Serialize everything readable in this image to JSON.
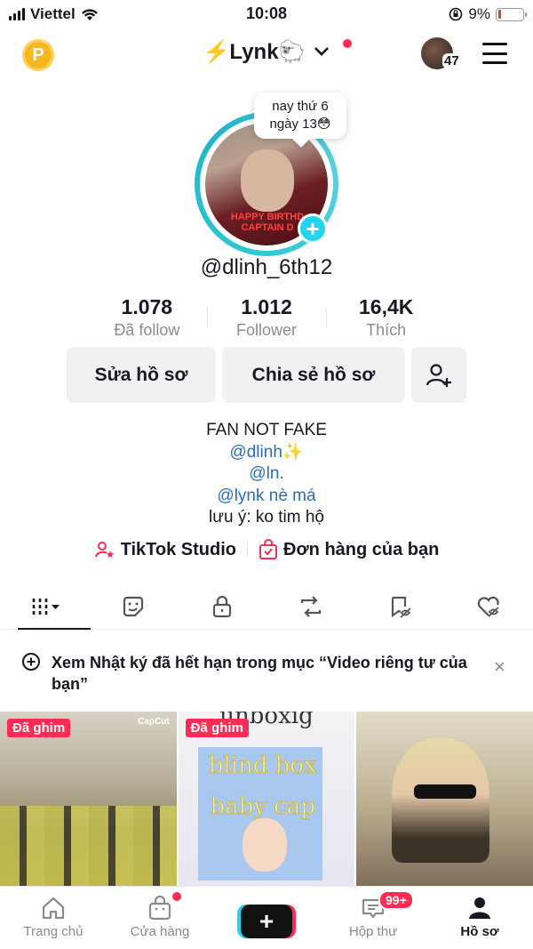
{
  "status_bar": {
    "carrier": "Viettel",
    "time": "10:08",
    "battery": "9%"
  },
  "top_nav": {
    "coin_label": "P",
    "account_name": "⚡️Lynk🐑",
    "friends_count": "47"
  },
  "profile": {
    "bubble_line1": "nay thứ 6",
    "bubble_line2": "ngày 13😳",
    "avatar_text_line1": "HAPPY BIRTHD",
    "avatar_text_line2": "CAPTAIN D",
    "username": "@dlinh_6th12",
    "stats": [
      {
        "value": "1.078",
        "label": "Đã follow"
      },
      {
        "value": "1.012",
        "label": "Follower"
      },
      {
        "value": "16,4K",
        "label": "Thích"
      }
    ],
    "edit_button": "Sửa hồ sơ",
    "share_button": "Chia sẻ hồ sơ",
    "bio": {
      "line1": "FAN NOT FAKE",
      "line2": "@dlinh✨",
      "line3": "@ln.",
      "line4": "@lynk nè má",
      "line5": "lưu ý: ko tim hộ"
    },
    "studio": "TikTok Studio",
    "orders": "Đơn hàng của bạn"
  },
  "notice": {
    "text": "Xem Nhật ký đã hết hạn trong mục “Video riêng tư của bạn”",
    "close": "×"
  },
  "videos": {
    "pinned_label": "Đã ghim",
    "capcut": "CapCut",
    "unbox_text": "unboxig",
    "blindbox_line1": "blind box",
    "blindbox_line2": "baby cap"
  },
  "bottom_nav": {
    "home": "Trang chủ",
    "shop": "Cửa hàng",
    "create": "+",
    "inbox": "Hộp thư",
    "inbox_badge": "99+",
    "profile": "Hồ sơ"
  },
  "colors": {
    "accent_pink": "#fe2c55",
    "accent_cyan": "#20d5ec",
    "link_blue": "#2b6db4"
  }
}
